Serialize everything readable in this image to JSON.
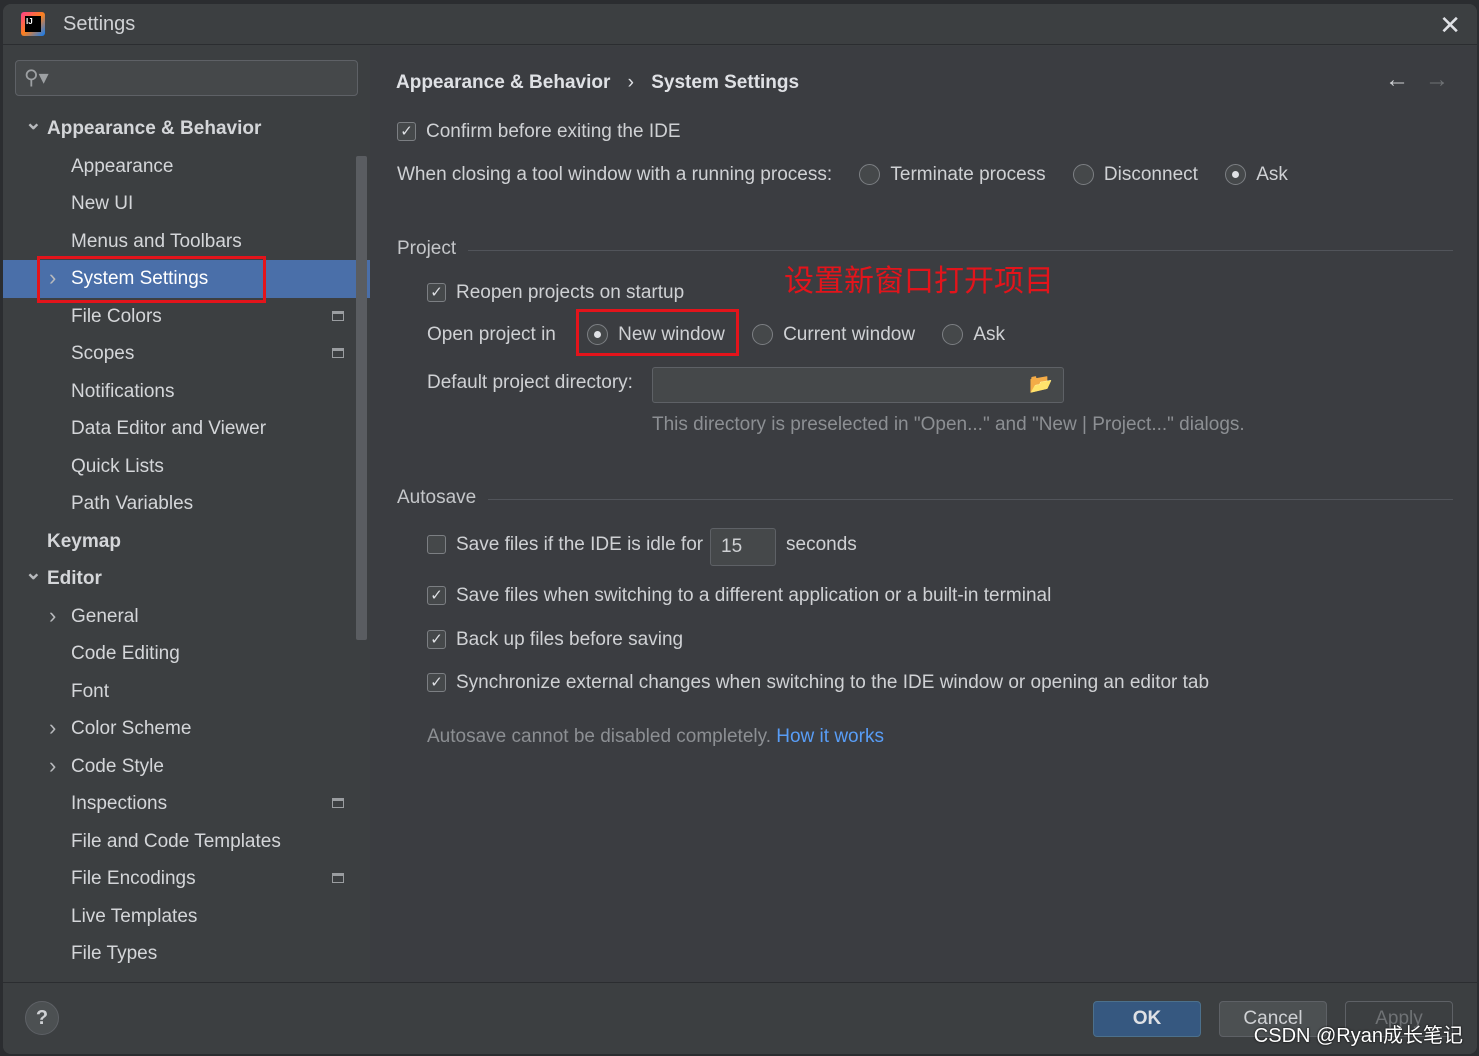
{
  "window": {
    "title": "Settings"
  },
  "search": {
    "placeholder": ""
  },
  "sidebar": {
    "items": [
      {
        "label": "Appearance & Behavior",
        "level": 0,
        "bold": true,
        "chevron": "down"
      },
      {
        "label": "Appearance",
        "level": 1
      },
      {
        "label": "New UI",
        "level": 1
      },
      {
        "label": "Menus and Toolbars",
        "level": 1
      },
      {
        "label": "System Settings",
        "level": 1,
        "chevron": "right",
        "selected": true
      },
      {
        "label": "File Colors",
        "level": 1,
        "badge": true
      },
      {
        "label": "Scopes",
        "level": 1,
        "badge": true
      },
      {
        "label": "Notifications",
        "level": 1
      },
      {
        "label": "Data Editor and Viewer",
        "level": 1
      },
      {
        "label": "Quick Lists",
        "level": 1
      },
      {
        "label": "Path Variables",
        "level": 1
      },
      {
        "label": "Keymap",
        "level": 0,
        "bold": true
      },
      {
        "label": "Editor",
        "level": 0,
        "bold": true,
        "chevron": "down"
      },
      {
        "label": "General",
        "level": 1,
        "chevron": "right"
      },
      {
        "label": "Code Editing",
        "level": 1
      },
      {
        "label": "Font",
        "level": 1
      },
      {
        "label": "Color Scheme",
        "level": 1,
        "chevron": "right"
      },
      {
        "label": "Code Style",
        "level": 1,
        "chevron": "right"
      },
      {
        "label": "Inspections",
        "level": 1,
        "badge": true
      },
      {
        "label": "File and Code Templates",
        "level": 1
      },
      {
        "label": "File Encodings",
        "level": 1,
        "badge": true
      },
      {
        "label": "Live Templates",
        "level": 1
      },
      {
        "label": "File Types",
        "level": 1
      }
    ]
  },
  "breadcrumb": {
    "parent": "Appearance & Behavior",
    "sep": "›",
    "current": "System Settings"
  },
  "general": {
    "confirm_exit": {
      "label": "Confirm before exiting the IDE",
      "checked": true
    },
    "closing_label": "When closing a tool window with a running process:",
    "closing_options": [
      {
        "label": "Terminate process",
        "selected": false
      },
      {
        "label": "Disconnect",
        "selected": false
      },
      {
        "label": "Ask",
        "selected": true
      }
    ]
  },
  "project": {
    "title": "Project",
    "reopen": {
      "label": "Reopen projects on startup",
      "checked": true
    },
    "open_in_label": "Open project in",
    "open_in_options": [
      {
        "label": "New window",
        "selected": true
      },
      {
        "label": "Current window",
        "selected": false
      },
      {
        "label": "Ask",
        "selected": false
      }
    ],
    "dir_label": "Default project directory:",
    "dir_value": "",
    "dir_hint": "This directory is preselected in \"Open...\" and \"New | Project...\" dialogs."
  },
  "annotation": "设置新窗口打开项目",
  "autosave": {
    "title": "Autosave",
    "idle": {
      "label": "Save files if the IDE is idle for",
      "checked": false,
      "value": "15",
      "unit": "seconds"
    },
    "switching": {
      "label": "Save files when switching to a different application or a built-in terminal",
      "checked": true
    },
    "backup": {
      "label": "Back up files before saving",
      "checked": true
    },
    "sync": {
      "label": "Synchronize external changes when switching to the IDE window or opening an editor tab",
      "checked": true
    },
    "note": "Autosave cannot be disabled completely.",
    "link": "How it works"
  },
  "footer": {
    "help": "?",
    "ok": "OK",
    "cancel": "Cancel",
    "apply": "Apply"
  },
  "watermark": "CSDN @Ryan成长笔记",
  "colors": {
    "selection": "#4a6fa9",
    "accent_link": "#589df6",
    "annotation": "#e3141b",
    "ok_button": "#365880"
  }
}
